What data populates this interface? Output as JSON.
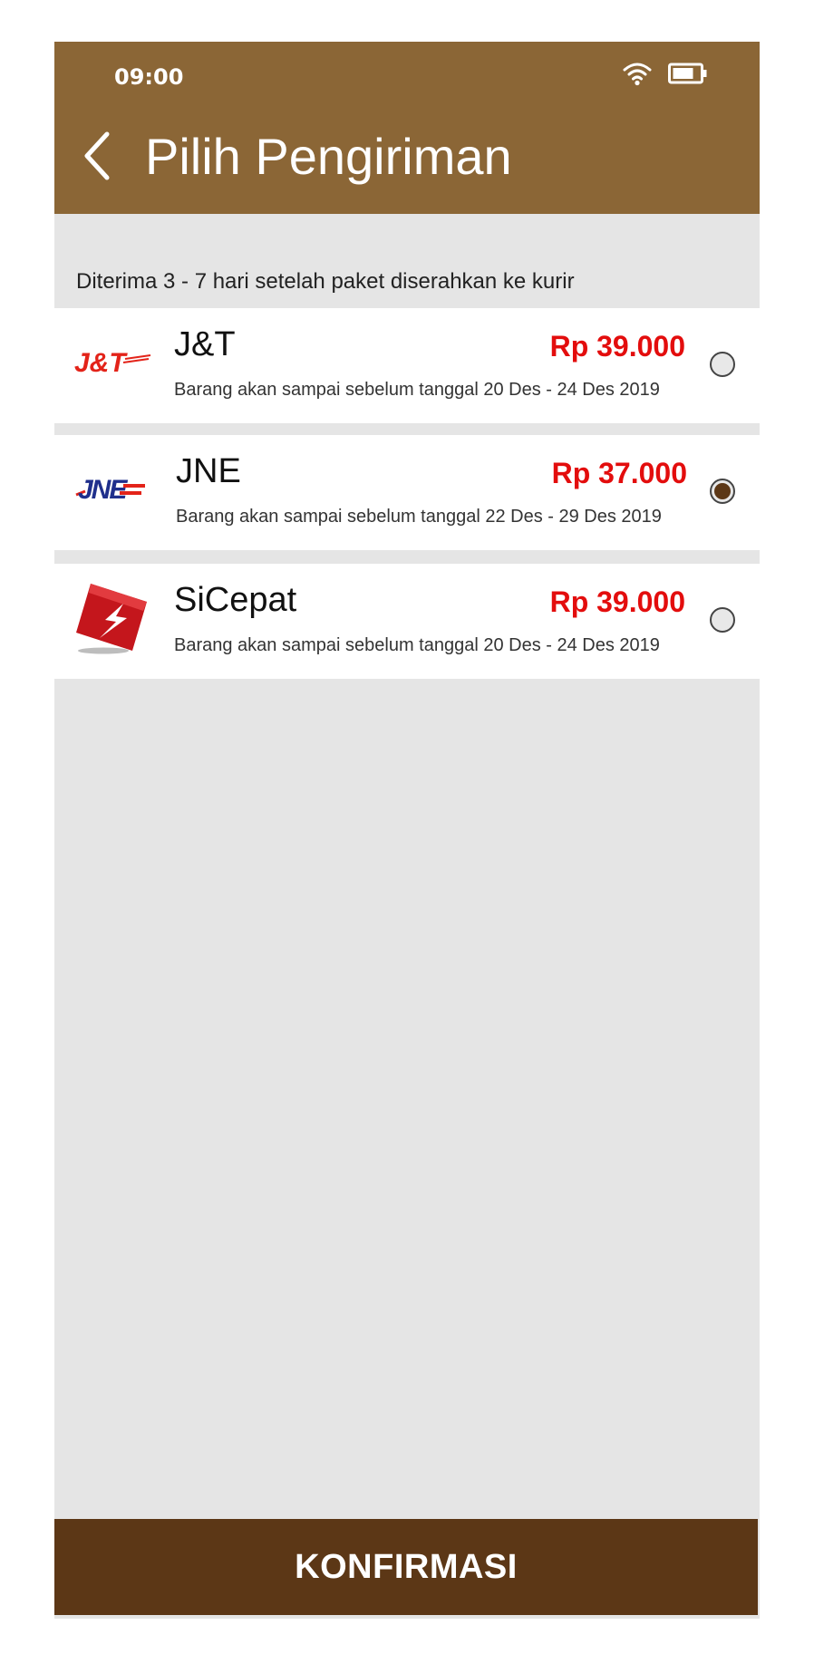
{
  "status_bar": {
    "time": "09:00",
    "wifi_icon": "wifi-icon",
    "battery_icon": "battery-icon"
  },
  "header": {
    "back_icon": "chevron-left-icon",
    "title": "Pilih Pengiriman"
  },
  "delivery_note": "Diterima 3 - 7 hari setelah paket diserahkan ke kurir",
  "couriers": [
    {
      "name": "J&T",
      "logo_text": "J&T",
      "price": "Rp 39.000",
      "eta": "Barang akan sampai sebelum tanggal 20 Des - 24 Des 2019",
      "selected": false
    },
    {
      "name": "JNE",
      "logo_text": "JNE",
      "price": "Rp 37.000",
      "eta": "Barang akan sampai sebelum tanggal 22 Des - 29 Des 2019",
      "selected": true
    },
    {
      "name": "SiCepat",
      "logo_text": "",
      "price": "Rp 39.000",
      "eta": "Barang akan sampai sebelum tanggal 20 Des - 24 Des 2019",
      "selected": false
    }
  ],
  "confirm_button": {
    "label": "KONFIRMASI"
  },
  "colors": {
    "header_bg": "#8b6636",
    "button_bg": "#5c3716",
    "price": "#e30d0d",
    "page_bg": "#e5e5e5"
  }
}
